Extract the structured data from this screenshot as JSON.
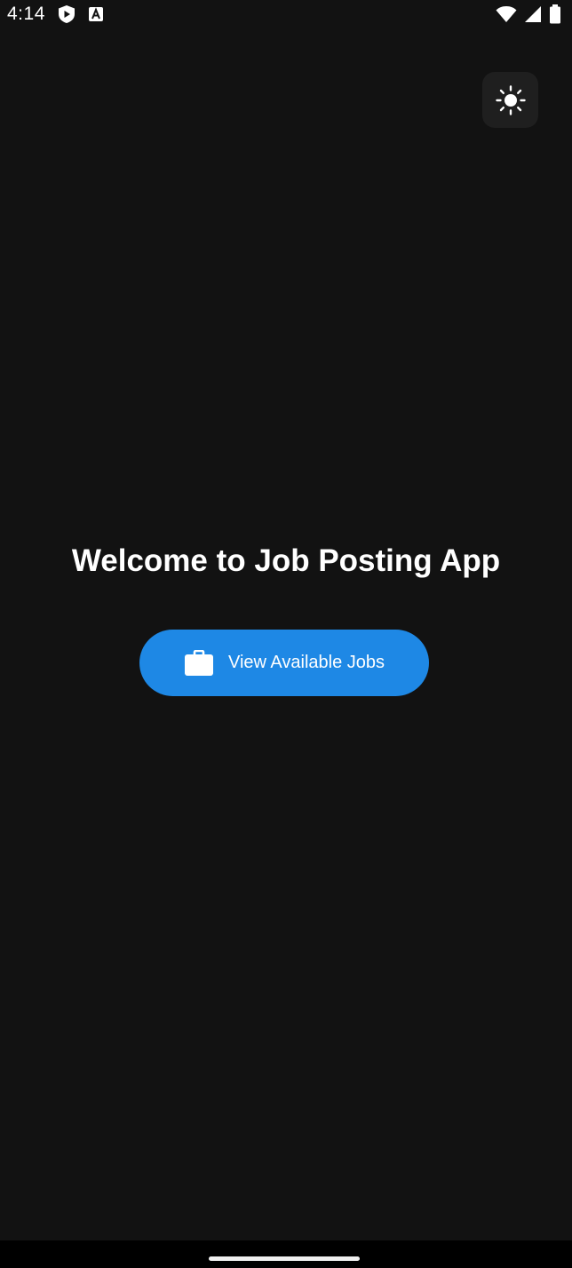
{
  "status_bar": {
    "time": "4:14",
    "left_icons": [
      "shield-play-icon",
      "font-a-icon"
    ],
    "right_icons": [
      "wifi-icon",
      "cell-signal-icon",
      "battery-icon"
    ]
  },
  "theme_toggle": {
    "icon": "sun-icon"
  },
  "main": {
    "title": "Welcome to Job Posting App",
    "primary_button": {
      "label": "View Available Jobs",
      "icon": "briefcase-icon"
    }
  },
  "colors": {
    "background": "#121212",
    "accent": "#1e88e5",
    "text": "#ffffff",
    "toggle_bg": "#1f1f1f",
    "nav_bar": "#000000"
  }
}
